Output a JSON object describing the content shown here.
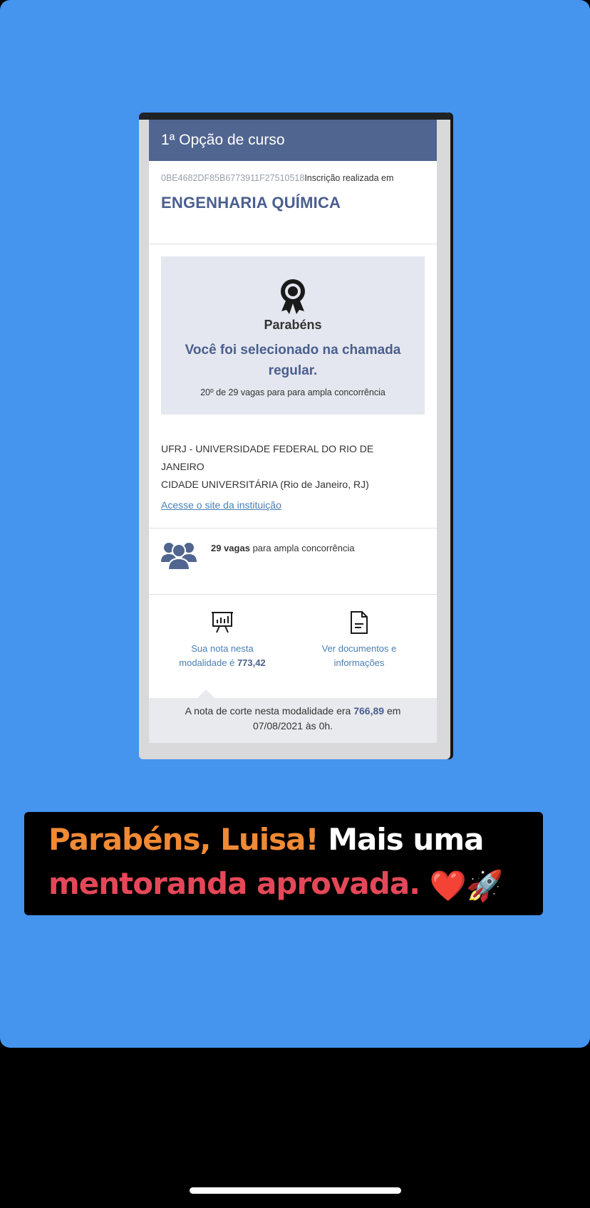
{
  "card": {
    "header": "1ª Opção de curso",
    "registration_code": "0BE4682DF85B6773911F27510518",
    "registration_label": "Inscrição realizada em",
    "course_name": "ENGENHARIA QUÍMICA"
  },
  "congrats": {
    "icon": "award-ribbon-icon",
    "title": "Parabéns",
    "message": "Você foi selecionado na chamada regular.",
    "rank": "20º de 29 vagas para para ampla concorrência"
  },
  "institution": {
    "name_line1": "UFRJ - UNIVERSIDADE FEDERAL DO RIO DE",
    "name_line2": "JANEIRO",
    "campus": "CIDADE UNIVERSITÁRIA (Rio de Janeiro, RJ)",
    "link": "Acesse o site da instituição"
  },
  "vagas": {
    "icon": "people-icon",
    "count": "29 vagas",
    "label": "para ampla concorrência"
  },
  "actions": {
    "score_icon": "chart-board-icon",
    "score_line1": "Sua nota nesta",
    "score_line2_prefix": "modalidade é",
    "score_value": "773,42",
    "docs_icon": "document-icon",
    "docs_line1": "Ver documentos e",
    "docs_line2": "informações"
  },
  "cutoff": {
    "prefix": "A nota de corte nesta modalidade era",
    "value": "766,89",
    "suffix": "em",
    "date": "07/08/2021 às 0h."
  },
  "caption": {
    "part1": "Parabéns, Luisa!",
    "part2": "Mais uma",
    "part3": "mentoranda aprovada.",
    "emoji1": "❤️",
    "emoji2": "🚀"
  },
  "colors": {
    "story_background": "#4594ee",
    "header": "#506590",
    "accent_blue": "#4a5f8e",
    "caption_orange": "#f08a35",
    "caption_red": "#e44858"
  }
}
